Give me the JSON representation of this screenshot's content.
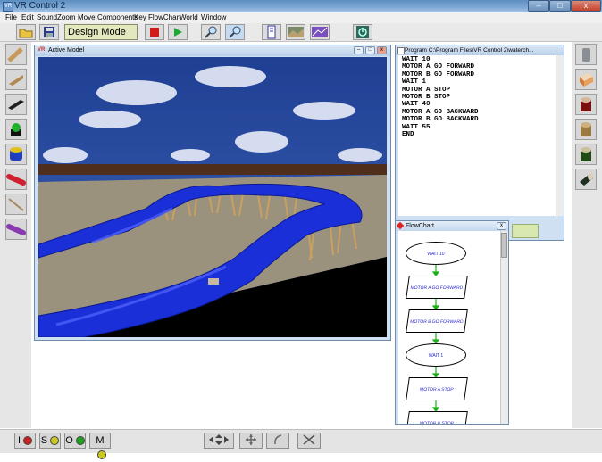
{
  "app": {
    "title": "VR Control 2",
    "icon_label": "VR"
  },
  "window_controls": {
    "minimize": "–",
    "maximize": "□",
    "close": "x"
  },
  "menu": [
    "File",
    "Edit",
    "Sound",
    "Zoom",
    "Move",
    "Components",
    "Key",
    "FlowChart",
    "World",
    "Window"
  ],
  "toolbar": {
    "open": "folder-icon",
    "save": "floppy-icon",
    "mode": "Design Mode",
    "stop": "stop-icon",
    "play": "play-icon",
    "zoom_in": "zoom-in-icon",
    "zoom_out": "zoom-out-icon",
    "program_view": "program-view-icon",
    "landscape_view": "landscape-view-icon",
    "chart_view": "chart-view-icon",
    "exit": "exit-icon"
  },
  "left_palette": [
    "wood-cylinder-icon",
    "wedge-icon",
    "flat-board-icon",
    "green-button-icon",
    "blue-cylinder-icon",
    "red-rod-icon",
    "thin-stick-icon",
    "purple-rod-icon"
  ],
  "right_palette": [
    "grey-cylinder-icon",
    "tan-cube-icon",
    "red-cylinder-icon",
    "wood-block-icon",
    "green-cylinder-icon",
    "dark-roller-icon"
  ],
  "model_window": {
    "title": "Active Model",
    "icon_label": "VR"
  },
  "program_window": {
    "title": "Program C:\\Program Files\\VR Control 2\\waterch...",
    "lines": [
      "WAIT 10",
      "MOTOR A GO FORWARD",
      "MOTOR B GO FORWARD",
      "WAIT 1",
      "MOTOR A STOP",
      "MOTOR B STOP",
      "WAIT 40",
      "MOTOR A GO BACKWARD",
      "MOTOR B GO BACKWARD",
      "WAIT 55",
      "END"
    ]
  },
  "flowchart_window": {
    "title": "FlowChart",
    "nodes": [
      {
        "shape": "oval",
        "label": "WAIT 10"
      },
      {
        "shape": "parallelogram",
        "label": "MOTOR A GO FORWARD"
      },
      {
        "shape": "parallelogram",
        "label": "MOTOR B GO FORWARD"
      },
      {
        "shape": "oval",
        "label": "WAIT 1"
      },
      {
        "shape": "parallelogram",
        "label": "MOTOR A STOP"
      },
      {
        "shape": "parallelogram",
        "label": "MOTOR B STOP"
      }
    ]
  },
  "bottom_bar": {
    "modes": [
      {
        "label": "I",
        "dot_color": "#c82020"
      },
      {
        "label": "S",
        "dot_color": "#c8c820"
      },
      {
        "label": "O",
        "dot_color": "#20a020"
      },
      {
        "label": "M",
        "dot_color": "#c8c820"
      }
    ],
    "move_icon": "move-arrows-icon",
    "pan_icon": "pan-icon",
    "rotate_icon": "rotate-icon",
    "delete_icon": "delete-x-icon"
  },
  "colors": {
    "water": "#1a2fd8",
    "sky": "#2d4a9a",
    "ground": "#9b927e",
    "trestle": "#c8a060"
  }
}
